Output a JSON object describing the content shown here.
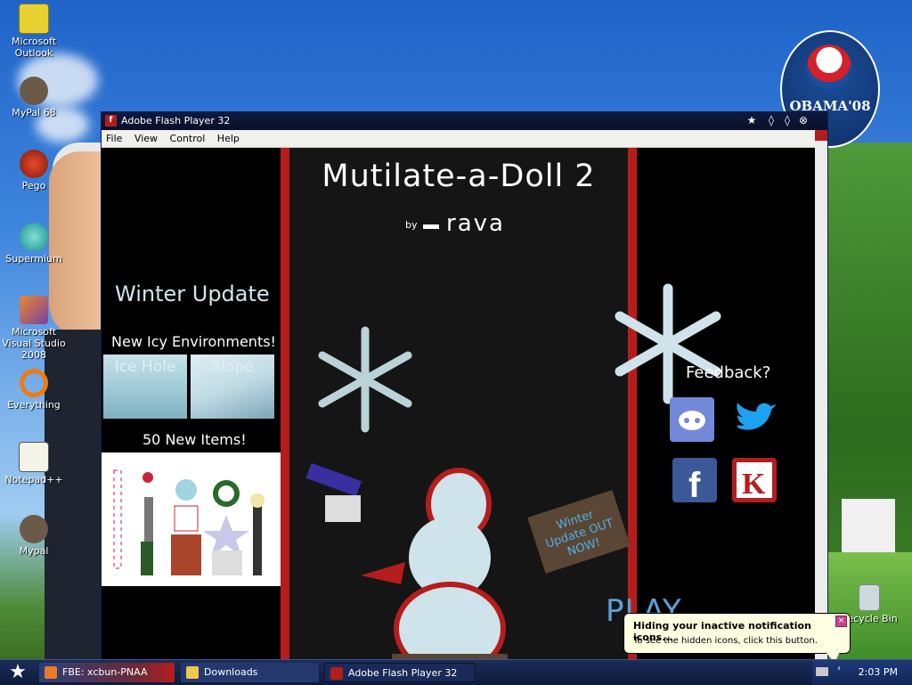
{
  "desktop_icons": [
    {
      "label": "Microsoft Outlook",
      "icon": "outlook-icon"
    },
    {
      "label": "MyPal 68",
      "icon": "mypal-icon"
    },
    {
      "label": "Pego",
      "icon": "pego-icon"
    },
    {
      "label": "Supermium",
      "icon": "supermium-icon"
    },
    {
      "label": "Microsoft Visual Studio 2008",
      "icon": "visual-studio-icon"
    },
    {
      "label": "Everything",
      "icon": "everything-icon"
    },
    {
      "label": "Notepad++",
      "icon": "notepadpp-icon"
    },
    {
      "label": "Mypal",
      "icon": "mypal-icon"
    },
    {
      "label": "Recycle Bin",
      "icon": "recycle-bin-icon"
    }
  ],
  "badge": {
    "text": "OBAMA'08"
  },
  "window": {
    "title": "Adobe Flash Player 32",
    "menu": [
      "File",
      "View",
      "Control",
      "Help"
    ]
  },
  "game": {
    "title": "Mutilate-a-Doll 2",
    "by": "by",
    "author": "rava",
    "left": {
      "heading": "Winter Update",
      "subheading": "New Icy Environments!",
      "environments": [
        "Ice Hole",
        "Slope"
      ],
      "items_heading": "50 New Items!"
    },
    "right": {
      "feedback": "Feedback?"
    },
    "sign_text": "Winter Update OUT NOW!",
    "play": "PLAY"
  },
  "notification": {
    "title": "Hiding your inactive notification icons...",
    "body": "To see the hidden icons, click this button."
  },
  "taskbar": {
    "tasks": [
      "FBE: xcbun-PNAA",
      "Downloads",
      "Adobe Flash Player 32"
    ],
    "clock": "2:03 PM"
  },
  "colors": {
    "flash_red": "#b51d1d",
    "discord": "#7289da",
    "twitter": "#1da1f2",
    "facebook": "#3b5998",
    "kongregate": "#b51d1d"
  }
}
